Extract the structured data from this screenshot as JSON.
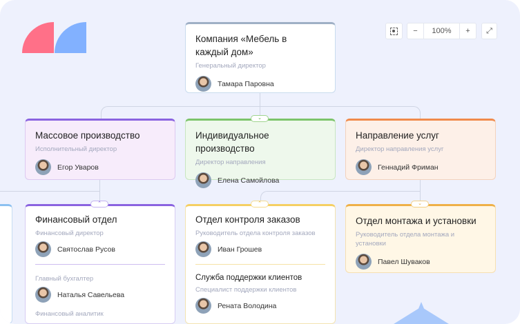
{
  "controls": {
    "fit_icon": "focus-icon",
    "zoom_out": "−",
    "zoom_level": "100%",
    "zoom_in": "+",
    "fullscreen_icon": "expand-icon"
  },
  "root": {
    "title": "Компания «Мебель в каждый дом»",
    "role": "Генеральный директор",
    "name": "Тамара Паровна"
  },
  "divisions": [
    {
      "title": "Массовое производство",
      "role": "Исполнительный директор",
      "name": "Егор Уваров"
    },
    {
      "title": "Индивидуальное производство",
      "role": "Директор направления",
      "name": "Елена Самойлова",
      "toggle": "⌄"
    },
    {
      "title": "Направление услуг",
      "role": "Директор направления услуг",
      "name": "Геннадий Фриман"
    }
  ],
  "departments": [
    {
      "title": "Финансовый отдел",
      "role": "Финансовый директор",
      "name": "Святослав Русов",
      "toggle": "⌃",
      "members": [
        {
          "role": "Главный бухгалтер",
          "name": "Наталья Савельева"
        },
        {
          "role": "Финансовый аналитик"
        }
      ]
    },
    {
      "title": "Отдел контроля заказов",
      "role": "Руководитель отдела контроля заказов",
      "name": "Иван Грошев",
      "toggle": "⌃",
      "sub": {
        "title": "Служба поддержки клиентов",
        "role": "Специалист поддержки клиентов",
        "name": "Рената Володина"
      }
    },
    {
      "title": "Отдел монтажа и установки",
      "role": "Руководитель отдела монтажа и установки",
      "name": "Павел Шуваков",
      "toggle": "⌄"
    }
  ],
  "colors": {
    "purple": "#8a63e0",
    "green": "#7cc46a",
    "orange": "#f08a4b",
    "yellow": "#f5cf63",
    "amber": "#eeb048",
    "blue": "#8cc0f0"
  }
}
